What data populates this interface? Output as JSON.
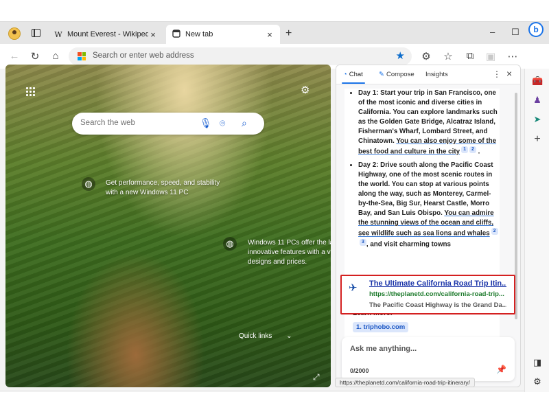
{
  "tabs": [
    {
      "icon": "W",
      "title": "Mount Everest - Wikipedia",
      "close": "×"
    },
    {
      "title": "New tab",
      "close": "×"
    }
  ],
  "new_tab_symbol": "+",
  "window_controls": {
    "minimize": "–",
    "maximize": "☐",
    "close": "×"
  },
  "address_bar": {
    "placeholder": "Search or enter web address"
  },
  "newtab_page": {
    "search_placeholder": "Search the web",
    "tip1": "Get performance, speed, and stability with a new Windows 11 PC",
    "tip2_line1": "Windows 11 PCs offer the la",
    "tip2_line2": "innovative features with a va",
    "tip2_line3": "designs and prices.",
    "quick_links": "Quick links"
  },
  "chat_panel": {
    "tabs": {
      "chat": "Chat",
      "compose": "Compose",
      "insights": "Insights"
    },
    "day1_plain": "Day 1: Start your trip in San Francisco, one of the most iconic and diverse cities in California. You can explore landmarks such as the Golden Gate Bridge, Alcatraz Island, Fisherman's Wharf, Lombard Street, and Chinatown. ",
    "day1_link": "You can also enjoy some of the best food and culture in the city",
    "day1_cites": [
      "1",
      "2"
    ],
    "day2_plain": "Day 2: Drive south along the Pacific Coast Highway, one of the most scenic routes in the world. You can stop at various points along the way, such as Monterey, Carmel-by-the-Sea, Big Sur, Hearst Castle, Morro Bay, and San Luis Obispo. ",
    "day2_link": "You can admire the stunning views of the ocean and cliffs, see wildlife such as sea lions and whales",
    "day2_cites": [
      "2",
      "3"
    ],
    "day2_tail": ", and visit charming towns",
    "learn_more": "Learn more:",
    "learn_link": "1. triphobo.com",
    "card": {
      "title": "The Ultimate California Road Trip Itin...",
      "url": "https://theplanetd.com/california-road-trip...",
      "desc": "The Pacific Coast Highway is the Grand Da..."
    },
    "input_placeholder": "Ask me anything...",
    "counter": "0/2000"
  },
  "status_url": "https://theplanetd.com/california-road-trip-itinerary/",
  "colors": {
    "accent": "#1a73e8",
    "highlight_border": "#d42020",
    "link_green": "#1c7a2b"
  }
}
